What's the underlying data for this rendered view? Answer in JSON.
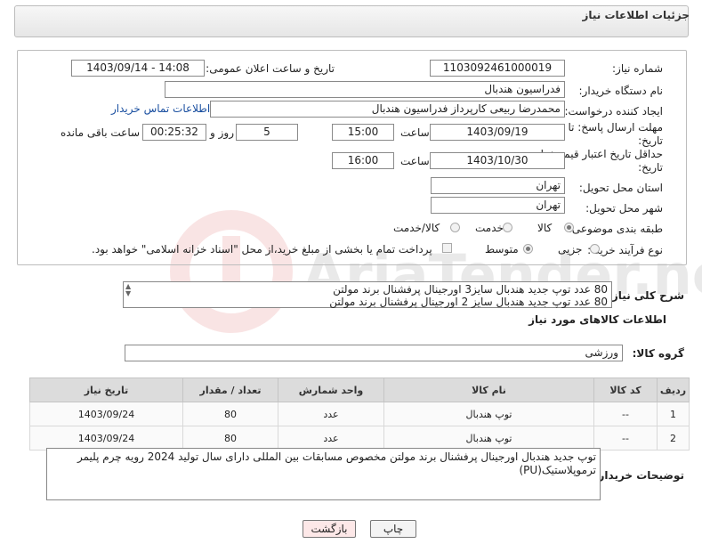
{
  "header": {
    "title": "جزئیات اطلاعات نیاز"
  },
  "form": {
    "need_number_label": "شماره نیاز:",
    "need_number": "1103092461000019",
    "announce_label": "تاریخ و ساعت اعلان عمومی:",
    "announce_value": "1403/09/14 - 14:08",
    "buyer_org_label": "نام دستگاه خریدار:",
    "buyer_org": "فدراسیون هندبال",
    "creator_label": "ایجاد کننده درخواست:",
    "creator": "محمدرضا ربیعی کارپرداز فدراسیون هندبال",
    "contact_link": "اطلاعات تماس خریدار",
    "deadline_label_1": "مهلت ارسال پاسخ: تا",
    "deadline_label_2": "تاریخ:",
    "deadline_date": "1403/09/19",
    "time_label": "ساعت",
    "deadline_time": "15:00",
    "days_value": "5",
    "days_label": "روز و",
    "remaining_value": "00:25:32",
    "remaining_label": "ساعت باقی مانده",
    "min_price_label_1": "حداقل تاریخ اعتبار قیمت: تا",
    "min_price_label_2": "تاریخ:",
    "min_price_date": "1403/10/30",
    "min_price_time": "16:00",
    "province_label": "استان محل تحویل:",
    "province": "تهران",
    "city_label": "شهر محل تحویل:",
    "city": "تهران",
    "category_label": "طبقه بندی موضوعی:",
    "category_options": [
      "کالا",
      "خدمت",
      "کالا/خدمت"
    ],
    "process_label": "نوع فرآیند خرید :",
    "process_options": [
      "جزیی",
      "متوسط"
    ],
    "payment_note": "پرداخت تمام یا بخشی از مبلغ خرید،از محل \"اسناد خزانه اسلامی\" خواهد بود."
  },
  "summary": {
    "label": "شرح کلی نیاز:",
    "line1": "80 عدد توپ جدید هندبال سایز3 اورجینال پرفشنال برند مولتن",
    "line2": "80 عدد توپ جدید هندبال سایز 2 اورجینال پرفشنال برند مولتن"
  },
  "goods": {
    "title": "اطلاعات کالاهای مورد نیاز",
    "group_label": "گروه کالا:",
    "group_value": "ورزشی",
    "columns": [
      "ردیف",
      "کد کالا",
      "نام کالا",
      "واحد شمارش",
      "تعداد / مقدار",
      "تاریخ نیاز"
    ],
    "rows": [
      [
        "1",
        "--",
        "توپ هندبال",
        "عدد",
        "80",
        "1403/09/24"
      ],
      [
        "2",
        "--",
        "توپ هندبال",
        "عدد",
        "80",
        "1403/09/24"
      ]
    ]
  },
  "buyer_notes": {
    "label": "توضیحات خریدار:",
    "text": "توپ جدید هندبال اورجینال پرفشنال برند مولتن مخصوص مسابقات بین المللی دارای سال تولید 2024 رویه چرم پلیمر ترموپلاستیک(PU)"
  },
  "buttons": {
    "print": "چاپ",
    "back": "بازگشت"
  },
  "watermark": {
    "text": "AriaTender.neT"
  },
  "colors": {
    "back_button_bg": "#fde8e8",
    "print_button_bg": "#f4f4f4",
    "link": "#1a4fa0"
  }
}
